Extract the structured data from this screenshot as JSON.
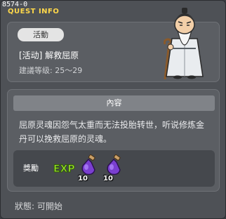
{
  "window": {
    "id_label": "8574-0",
    "title": "QUEST INFO"
  },
  "quest": {
    "category_tag": "活動",
    "name": "[活动] 解救屈原",
    "level_text": "建議等级: 25～29"
  },
  "content": {
    "header": "內容",
    "description": "屈原灵魂因怨气太重而无法投胎转世，听说修炼金丹可以挽救屈原的灵魂。"
  },
  "reward": {
    "label": "獎勵",
    "exp_label": "EXP",
    "items": [
      {
        "icon": "purple-potion-icon",
        "quantity": "10"
      },
      {
        "icon": "purple-potion-icon",
        "quantity": "10"
      }
    ]
  },
  "status": {
    "text": "狀態:  可開始"
  },
  "colors": {
    "title": "#ffd84a",
    "exp_green": "#9be22a",
    "potion_purple": "#7a3fd0"
  }
}
